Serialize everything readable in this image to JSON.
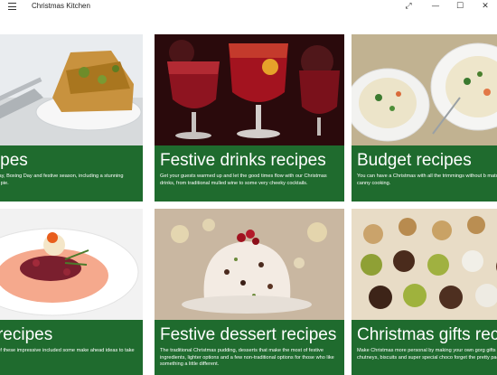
{
  "window": {
    "title": "Christmas Kitchen",
    "controls": {
      "expand": "⤢",
      "minimize": "—",
      "maximize": "☐",
      "close": "✕"
    }
  },
  "colors": {
    "band_green": "#1f6b2e",
    "band_text": "#ffffff"
  },
  "cards": [
    {
      "title": "arian recipes",
      "description": "ditional spread on Christmas Day, Boxing Day and festive season, including a stunning centre-piece - barley & spinach pie."
    },
    {
      "title": "Festive drinks recipes",
      "description": "Get your guests warmed up and let the good times flow with our Christmas drinks, from traditional mulled wine to some very cheeky cocktails."
    },
    {
      "title": "Budget recipes",
      "description": "You can have a Christmas with all the trimmings without b match, with a bit of canny cooking."
    },
    {
      "title": "e starter recipes",
      "description": "your Christmas meal with one of these impressive included some make ahead ideas to take the pressure"
    },
    {
      "title": "Festive dessert recipes",
      "description": "The traditional Christmas pudding, desserts that make the most of festive ingredients, lighter options and a few non-traditional options for those who like something a little different."
    },
    {
      "title": "Christmas gifts recipes",
      "description": "Make Christmas more personal by making your own gorg gifts including chutneys, biscuits and super special choco forget the pretty packaging!"
    }
  ]
}
